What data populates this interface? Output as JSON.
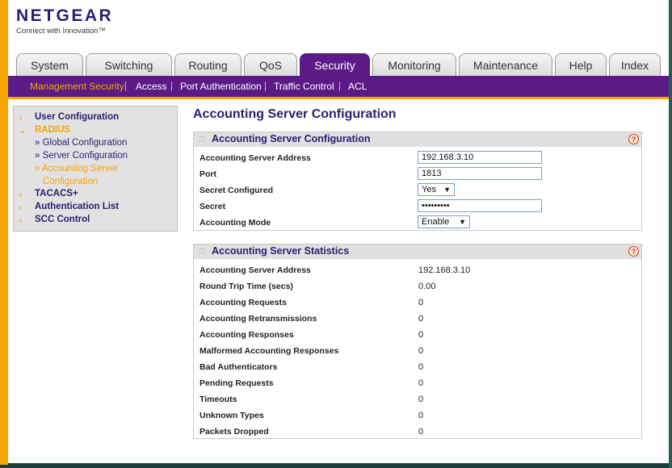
{
  "brand": {
    "logo": "NETGEAR",
    "tagline": "Connect with Innovation™"
  },
  "tabs": [
    {
      "label": "System"
    },
    {
      "label": "Switching"
    },
    {
      "label": "Routing"
    },
    {
      "label": "QoS"
    },
    {
      "label": "Security"
    },
    {
      "label": "Monitoring"
    },
    {
      "label": "Maintenance"
    },
    {
      "label": "Help"
    },
    {
      "label": "Index"
    }
  ],
  "subnav": [
    {
      "label": "Management Security"
    },
    {
      "label": "Access"
    },
    {
      "label": "Port Authentication"
    },
    {
      "label": "Traffic Control"
    },
    {
      "label": "ACL"
    }
  ],
  "sidebar": {
    "user_configuration": "User Configuration",
    "radius": "RADIUS",
    "global_configuration": "» Global Configuration",
    "server_configuration": "» Server Configuration",
    "accounting_server_line1": "» Accounting Server",
    "accounting_server_line2": "Configuration",
    "tacacs": "TACACS+",
    "authentication_list": "Authentication List",
    "scc_control": "SCC Control"
  },
  "page_title": "Accounting Server Configuration",
  "config_panel": {
    "title": "Accounting Server Configuration",
    "address_label": "Accounting Server Address",
    "address_value": "192.168.3.10",
    "port_label": "Port",
    "port_value": "1813",
    "secret_configured_label": "Secret Configured",
    "secret_configured_value": "Yes",
    "secret_label": "Secret",
    "secret_value": "•••••••••",
    "mode_label": "Accounting Mode",
    "mode_value": "Enable"
  },
  "stats_panel": {
    "title": "Accounting Server Statistics",
    "rows": [
      {
        "label": "Accounting Server Address",
        "value": "192.168.3.10"
      },
      {
        "label": "Round Trip Time (secs)",
        "value": "0.00"
      },
      {
        "label": "Accounting Requests",
        "value": "0"
      },
      {
        "label": "Accounting Retransmissions",
        "value": "0"
      },
      {
        "label": "Accounting Responses",
        "value": "0"
      },
      {
        "label": "Malformed Accounting Responses",
        "value": "0"
      },
      {
        "label": "Bad Authenticators",
        "value": "0"
      },
      {
        "label": "Pending Requests",
        "value": "0"
      },
      {
        "label": "Timeouts",
        "value": "0"
      },
      {
        "label": "Unknown Types",
        "value": "0"
      },
      {
        "label": "Packets Dropped",
        "value": "0"
      }
    ]
  },
  "help_glyph": "?",
  "colors": {
    "brand_purple": "#5b1a86",
    "accent_orange": "#f7a600",
    "title_navy": "#2b1d6f"
  }
}
